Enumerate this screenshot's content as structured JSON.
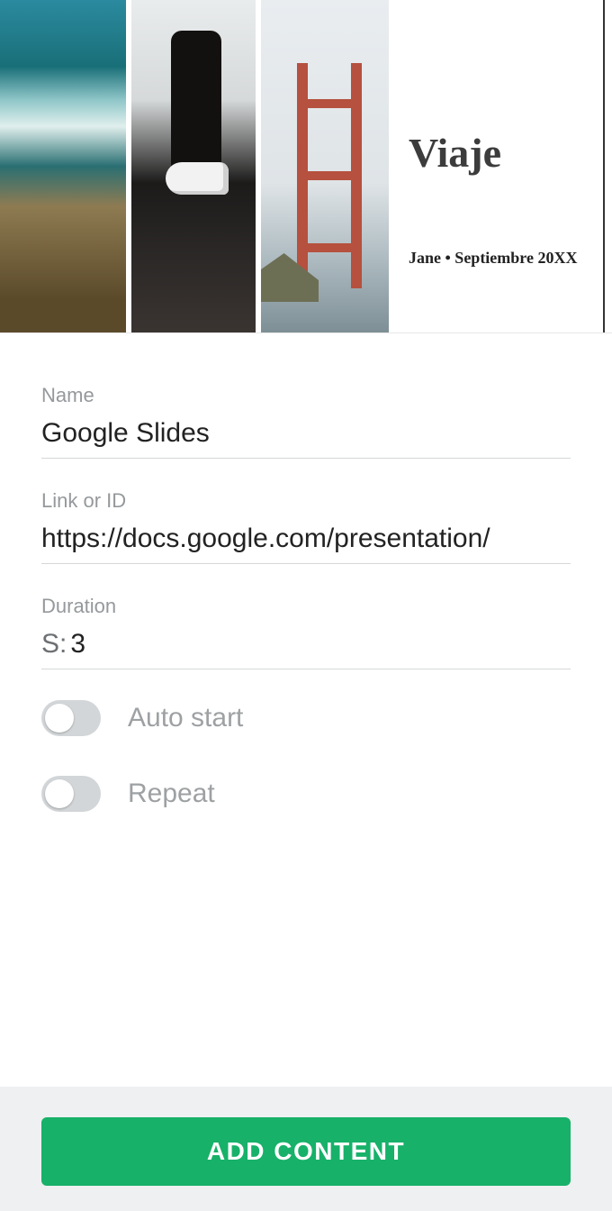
{
  "preview": {
    "title": "Viaje",
    "byline": "Jane • Septiembre 20XX"
  },
  "form": {
    "name_label": "Name",
    "name_value": "Google Slides",
    "link_label": "Link or ID",
    "link_value": "https://docs.google.com/presentation/",
    "duration_label": "Duration",
    "duration_prefix": "S:",
    "duration_value": "3",
    "auto_start_label": "Auto start",
    "auto_start_on": false,
    "repeat_label": "Repeat",
    "repeat_on": false
  },
  "footer": {
    "add_button": "ADD CONTENT"
  }
}
